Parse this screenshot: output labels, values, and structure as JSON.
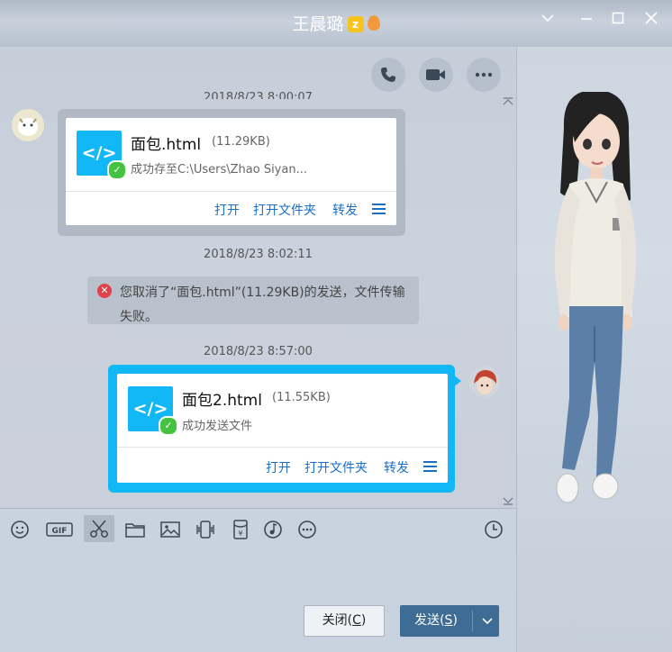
{
  "window": {
    "title": "王晨璐",
    "badge_letter": "z"
  },
  "chat": {
    "top_stamp_partial": "2018/8/23 8:00:07",
    "messages": [
      {
        "file_name": "面包.html",
        "file_size": "(11.29KB)",
        "status": "成功存至C:\\Users\\Zhao Siyan...",
        "actions": [
          "打开",
          "打开文件夹",
          "转发"
        ]
      }
    ],
    "stamp_2": "2018/8/23 8:02:11",
    "system_message": "您取消了“面包.html”(11.29KB)的发送，文件传输失败。",
    "stamp_3": "2018/8/23 8:57:00",
    "sent": {
      "file_name": "面包2.html",
      "file_size": "(11.55KB)",
      "status": "成功发送文件",
      "actions": [
        "打开",
        "打开文件夹",
        "转发"
      ]
    },
    "file_icon_glyph": "</>"
  },
  "buttons": {
    "close_label": "关闭(",
    "close_key": "C",
    "close_tail": ")",
    "send_label": "发送(",
    "send_key": "S",
    "send_tail": ")"
  },
  "colors": {
    "accent": "#12b7f5",
    "send_button": "#3e6c94",
    "link": "#1a6fc4",
    "success": "#44c240",
    "error": "#e0424c"
  }
}
